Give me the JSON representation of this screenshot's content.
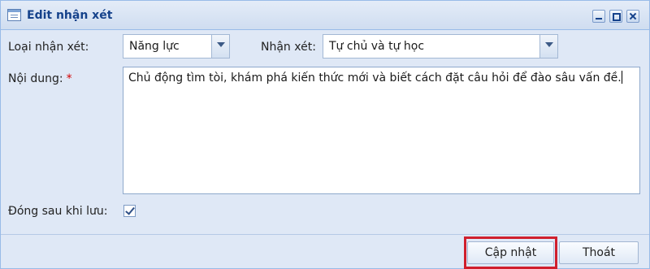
{
  "window": {
    "title": "Edit nhận xét",
    "tool_icons": [
      "minimize-icon",
      "maximize-icon",
      "close-icon"
    ]
  },
  "form": {
    "loai_label": "Loại nhận xét:",
    "loai_value": "Năng lực",
    "nhan_xet_label": "Nhận xét:",
    "nhan_xet_value": "Tự chủ và tự học",
    "noi_dung_label": "Nội dung:",
    "required_mark": "*",
    "noi_dung_value": "Chủ động tìm tòi, khám phá kiến thức mới và biết cách đặt câu hỏi để đào sâu vấn đề.",
    "dong_sau_label": "Đóng sau khi lưu:",
    "dong_sau_checked": true
  },
  "buttons": {
    "update_label": "Cập nhật",
    "exit_label": "Thoát"
  },
  "colors": {
    "window_bg": "#dfe8f6",
    "title_text": "#15428b",
    "required": "#d40000",
    "highlight_border": "#d01f2d"
  }
}
